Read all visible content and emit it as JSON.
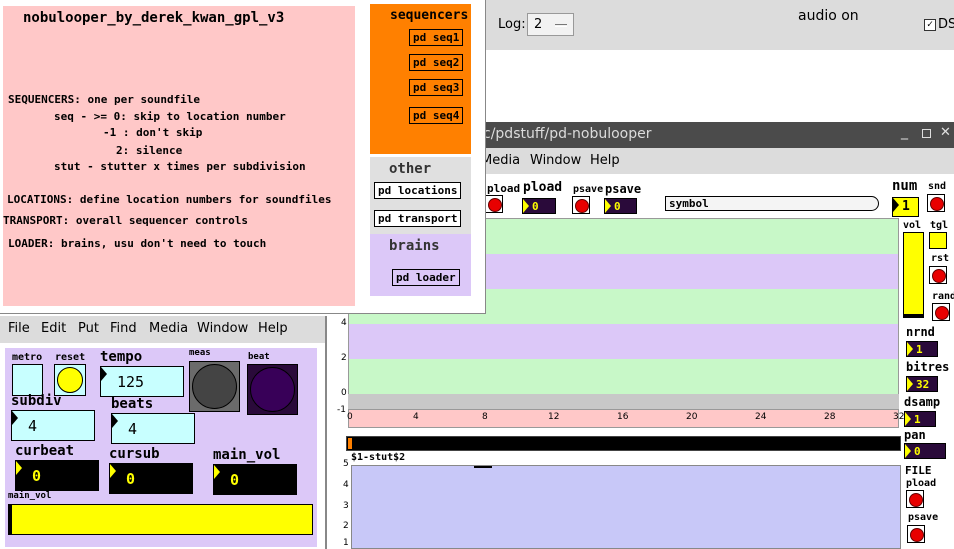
{
  "pd_main": {
    "log_label": "Log:",
    "log_value": "2",
    "audio_status": "audio on",
    "dsp_label": "DS"
  },
  "notes": {
    "title": "nobulooper_by_derek_kwan_gpl_v3",
    "lines": [
      "SEQUENCERS: one per soundfile",
      "seq - >= 0: skip to location number",
      "-1 : don't skip",
      "2: silence",
      "stut - stutter x times per subdivision",
      "LOCATIONS: define location numbers for soundfiles",
      "TRANSPORT: overall sequencer controls",
      "LOADER: brains, usu don't need to touch"
    ],
    "sequencers_heading": "sequencers",
    "seq_boxes": [
      "pd seq1",
      "pd seq2",
      "pd seq3",
      "pd seq4"
    ],
    "other_heading": "other",
    "other_boxes": [
      "pd locations",
      "pd transport"
    ],
    "brains_heading": "brains",
    "brains_box": "pd loader",
    "colors": {
      "pink": "#ffc8c8",
      "orange": "#ff8000",
      "lightgray": "#e0e0e0",
      "lavender": "#dcc8f8"
    }
  },
  "nobu": {
    "title": "c/pdstuff/pd-nobulooper",
    "menu": [
      "Media",
      "Window",
      "Help"
    ],
    "top_controls": {
      "pload1": "pload",
      "pload2": "pload",
      "psave1": "psave",
      "psave2": "psave",
      "pload_num": "0",
      "psave_num": "0",
      "symbol_box": "symbol"
    },
    "num_label": "num",
    "num_value": "1",
    "right_panel": {
      "snd": "snd",
      "vol": "vol",
      "tgl": "tgl",
      "rst": "rst",
      "rand": "rand",
      "nrnd": "nrnd",
      "nrnd_value": "1",
      "bitres": "bitres",
      "bitres_value": "32",
      "dsamp": "dsamp",
      "dsamp_value": "1",
      "pan": "pan",
      "pan_value": "0",
      "file": "FILE",
      "pload": "pload",
      "psave": "psave"
    },
    "graph_y_ticks": [
      "4",
      "2",
      "0",
      "-1"
    ],
    "graph_x_ticks": [
      "0",
      "4",
      "8",
      "12",
      "16",
      "20",
      "24",
      "28",
      "32"
    ],
    "stut_label": "$1-stut$2",
    "stut_y_ticks": [
      "5",
      "4",
      "3",
      "2",
      "1"
    ]
  },
  "ctrl": {
    "menu": [
      "File",
      "Edit",
      "Put",
      "Find",
      "Media",
      "Window",
      "Help"
    ],
    "metro": "metro",
    "reset": "reset",
    "tempo": "tempo",
    "tempo_value": "125",
    "meas": "meas",
    "beat": "beat",
    "subdiv": "subdiv",
    "subdiv_value": "4",
    "beats": "beats",
    "beats_value": "4",
    "curbeat": "curbeat",
    "curbeat_value": "0",
    "cursub": "cursub",
    "cursub_value": "0",
    "main_vol": "main_vol",
    "main_vol_value": "0",
    "main_vol_slider": "main_vol",
    "colors": {
      "bg": "#dcc8f8",
      "cyan": "#c8ffff",
      "yellow": "#ffff00"
    }
  }
}
